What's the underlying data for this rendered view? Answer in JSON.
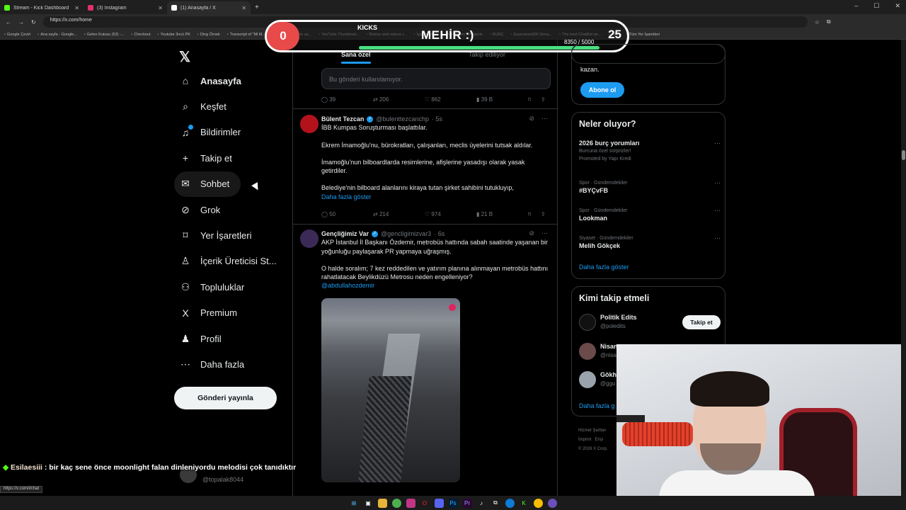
{
  "browser": {
    "tabs": [
      {
        "label": "Stream - Kick Dashboard",
        "color": "#53fc18"
      },
      {
        "label": "(3) Instagram",
        "color": "#e1306c"
      },
      {
        "label": "(1) Anasayfa / X",
        "color": "#ffffff"
      }
    ],
    "url": "https://x.com/home",
    "bookmarks": [
      "Google Çeviri",
      "Ana sayfa - Google...",
      "Gelen Kutusu (52) -...",
      "Checkout",
      "Youtube 3ncü PK",
      "Ding Örnek",
      "Transcript of \"Mi M...",
      "CapCut | Text to sp...",
      "YouTube Thumbnail...",
      "Resize and reduce i...",
      "İşpeyiciya Ö...",
      "HeyGen - Projects",
      "BURÇ",
      "Esperanza000 Strea...",
      "The best ChatBot an...",
      "Flow",
      "Tüm Yer İşaretleri"
    ]
  },
  "kicks": {
    "left_count": "0",
    "title": "KICKS",
    "name": "MEHİR :)",
    "progress_text": "8350 / 5000",
    "progress_fraction": 1.0,
    "right_count": "25",
    "accent": "#e84a4a"
  },
  "nav": {
    "items": [
      {
        "label": "Anasayfa",
        "icon": "home-icon",
        "glyph": "⌂"
      },
      {
        "label": "Keşfet",
        "icon": "search-icon",
        "glyph": "⌕"
      },
      {
        "label": "Bildirimler",
        "icon": "bell-icon",
        "glyph": "♫"
      },
      {
        "label": "Takip et",
        "icon": "person-add-icon",
        "glyph": "+"
      },
      {
        "label": "Sohbet",
        "icon": "mail-icon",
        "glyph": "✉"
      },
      {
        "label": "Grok",
        "icon": "grok-icon",
        "glyph": "⊘"
      },
      {
        "label": "Yer İşaretleri",
        "icon": "bookmark-icon",
        "glyph": "⌑"
      },
      {
        "label": "İçerik Üreticisi St...",
        "icon": "creator-icon",
        "glyph": "♙"
      },
      {
        "label": "Topluluklar",
        "icon": "communities-icon",
        "glyph": "⚇"
      },
      {
        "label": "Premium",
        "icon": "x-icon",
        "glyph": "X"
      },
      {
        "label": "Profil",
        "icon": "profile-icon",
        "glyph": "♟"
      },
      {
        "label": "Daha fazla",
        "icon": "more-icon",
        "glyph": "⋯"
      }
    ],
    "post_button": "Gönderi yayınla",
    "account_handle": "@topalak8044",
    "status_url": "https://x.com/i/chat"
  },
  "timeline": {
    "tab_for_you": "Sana özel",
    "tab_following": "Takip ediliyor",
    "unavailable": "Bu gönderi kullanılamıyor.",
    "post0_stats": {
      "replies": "39",
      "reposts": "206",
      "likes": "862",
      "views": "39 B"
    },
    "post1": {
      "name": "Bülent Tezcan",
      "handle": "@bulenttezcanchp",
      "time": "· 5s",
      "text1": "İBB Kumpas Soruşturması başlattılar.",
      "text2": "Ekrem İmamoğlu'nu, bürokratları, çalışanları, meclis üyelerini tutsak aldılar.",
      "text3": "İmamoğlu'nun bilboardlarda resimlerine, afişlerine yasadışı olarak yasak getirdiler.",
      "text4": "Belediye'nin bilboard alanlarını kiraya tutan şirket sahibini tutukluyıp,",
      "more": "Daha fazla göster",
      "stats": {
        "replies": "50",
        "reposts": "214",
        "likes": "974",
        "views": "21 B"
      }
    },
    "post2": {
      "name": "Gençliğimiz Var",
      "handle": "@gencligimizvar3",
      "time": "· 6s",
      "text1": "AKP İstanbul İl Başkanı Özdemir, metrobüs hattında sabah saatinde yaşanan bir yoğunluğu paylaşarak PR yapmaya uğraşmış.",
      "text2": "O halde soralım; 7 kez reddedilen ve yatırım planına alınmayan metrobüs hattını rahatlatacak Beylikdüzü Metrosu neden engelleniyor?",
      "mention": "@abdullahozdemir"
    }
  },
  "right": {
    "premium_text": "kazan.",
    "subscribe": "Abone ol",
    "trends_title": "Neler oluyor?",
    "trends": [
      {
        "meta": "",
        "title": "2026 burç yorumları",
        "sub": "Burcuna özel sürprizler!",
        "promo": "Promoted by Yapı Kredi"
      },
      {
        "meta": "Spor · Gündemdekiler",
        "title": "#BYÇvFB",
        "sub": "",
        "promo": ""
      },
      {
        "meta": "Spor · Gündemdekiler",
        "title": "Lookman",
        "sub": "",
        "promo": ""
      },
      {
        "meta": "Siyaset · Gündemdekiler",
        "title": "Melih Gökçek",
        "sub": "",
        "promo": ""
      }
    ],
    "show_more": "Daha fazla göster",
    "who_title": "Kimi takip etmeli",
    "who": [
      {
        "name": "Politik Edits",
        "handle": "@poledits",
        "follow": "Takip et"
      },
      {
        "name": "Nisan",
        "handle": "@nisa",
        "follow": ""
      },
      {
        "name": "Gökh",
        "handle": "@ggu",
        "follow": ""
      }
    ],
    "who_more": "Daha fazla g",
    "footer1": "Hizmet Şartları",
    "footer2": "İmprint",
    "footer3": "Erişi",
    "footer4": "© 2026 X Corp."
  },
  "chat": {
    "user": "Esilaesiii",
    "message": ": bir kaç sene önce moonlight falan dinleniyordu melodisi çok tanıdıktır"
  }
}
